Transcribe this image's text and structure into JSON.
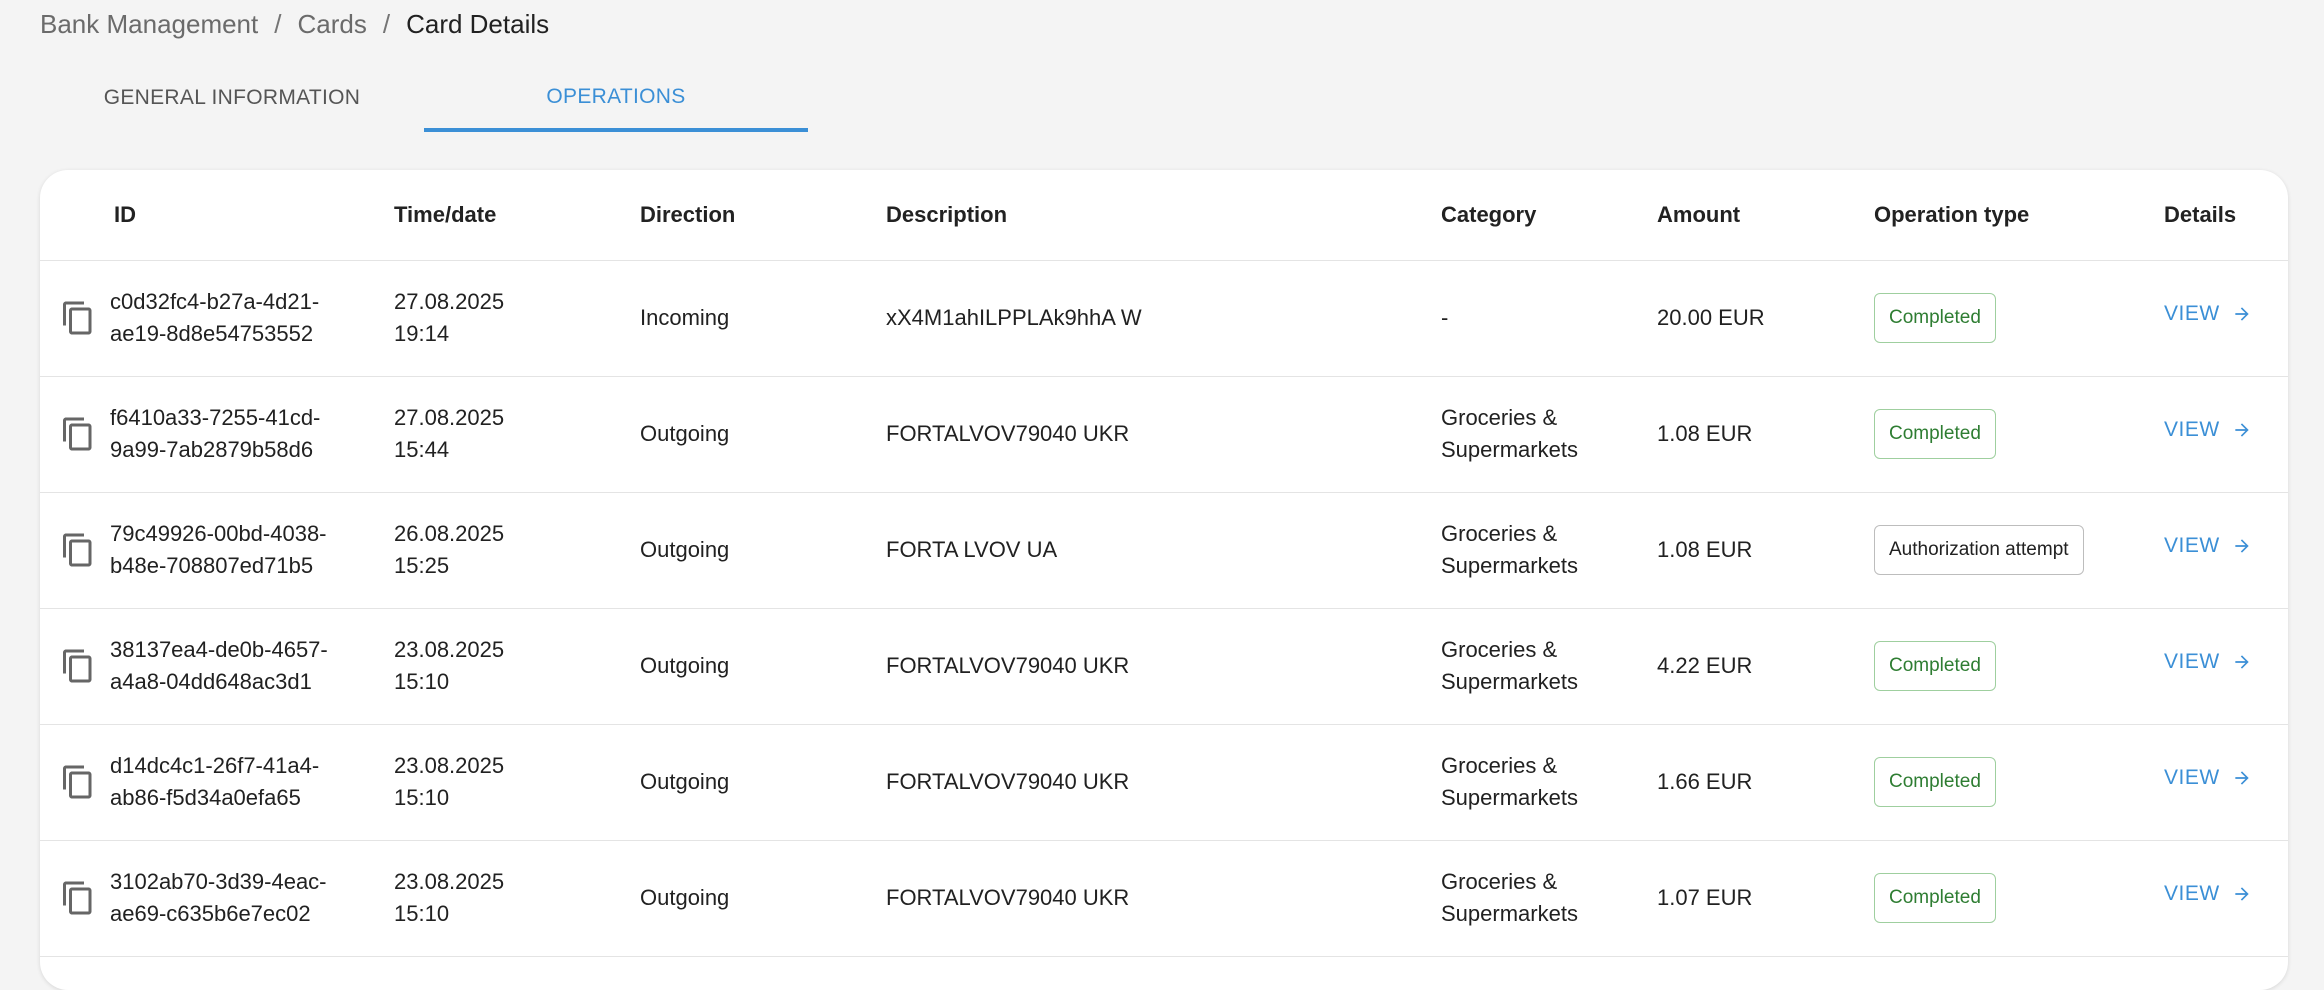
{
  "breadcrumb": {
    "items": [
      "Bank Management",
      "Cards",
      "Card Details"
    ],
    "separator": "/"
  },
  "tabs": [
    {
      "label": "GENERAL INFORMATION",
      "active": false
    },
    {
      "label": "OPERATIONS",
      "active": true
    }
  ],
  "table": {
    "headers": {
      "id": "ID",
      "time": "Time/date",
      "direction": "Direction",
      "description": "Description",
      "category": "Category",
      "amount": "Amount",
      "op_type": "Operation type",
      "details": "Details"
    },
    "view_label": "VIEW",
    "rows": [
      {
        "id1": "c0d32fc4-b27a-4d21-",
        "id2": "ae19-8d8e54753552",
        "date": "27.08.2025",
        "time": "19:14",
        "direction": "Incoming",
        "description": "xX4M1ahILPPLAk9hhA W",
        "cat1": "-",
        "cat2": "",
        "amount": "20.00 EUR",
        "op_type": "Completed"
      },
      {
        "id1": "f6410a33-7255-41cd-",
        "id2": "9a99-7ab2879b58d6",
        "date": "27.08.2025",
        "time": "15:44",
        "direction": "Outgoing",
        "description": "FORTALVOV79040 UKR",
        "cat1": "Groceries &",
        "cat2": "Supermarkets",
        "amount": "1.08 EUR",
        "op_type": "Completed"
      },
      {
        "id1": "79c49926-00bd-4038-",
        "id2": "b48e-708807ed71b5",
        "date": "26.08.2025",
        "time": "15:25",
        "direction": "Outgoing",
        "description": "FORTA LVOV UA",
        "cat1": "Groceries &",
        "cat2": "Supermarkets",
        "amount": "1.08 EUR",
        "op_type": "Authorization attempt"
      },
      {
        "id1": "38137ea4-de0b-4657-",
        "id2": "a4a8-04dd648ac3d1",
        "date": "23.08.2025",
        "time": "15:10",
        "direction": "Outgoing",
        "description": "FORTALVOV79040 UKR",
        "cat1": "Groceries &",
        "cat2": "Supermarkets",
        "amount": "4.22 EUR",
        "op_type": "Completed"
      },
      {
        "id1": "d14dc4c1-26f7-41a4-",
        "id2": "ab86-f5d34a0efa65",
        "date": "23.08.2025",
        "time": "15:10",
        "direction": "Outgoing",
        "description": "FORTALVOV79040 UKR",
        "cat1": "Groceries &",
        "cat2": "Supermarkets",
        "amount": "1.66 EUR",
        "op_type": "Completed"
      },
      {
        "id1": "3102ab70-3d39-4eac-",
        "id2": "ae69-c635b6e7ec02",
        "date": "23.08.2025",
        "time": "15:10",
        "direction": "Outgoing",
        "description": "FORTALVOV79040 UKR",
        "cat1": "Groceries &",
        "cat2": "Supermarkets",
        "amount": "1.07 EUR",
        "op_type": "Completed"
      }
    ]
  },
  "colors": {
    "accent": "#3b8fd6",
    "completed": "#2e7d32",
    "background": "#f4f4f4"
  },
  "icons": {
    "copy": "copy-icon",
    "arrow": "arrow-right-icon"
  }
}
